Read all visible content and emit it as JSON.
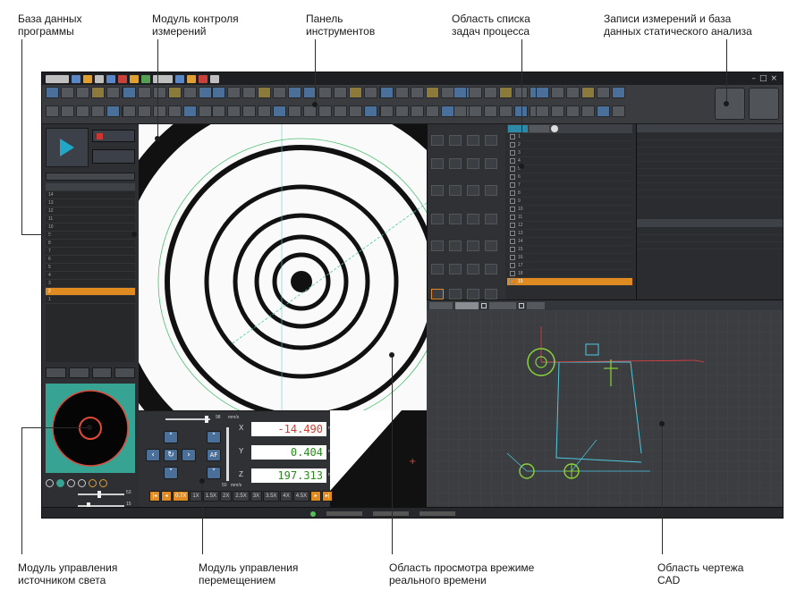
{
  "labels": {
    "program_database": [
      "База данных",
      "программы"
    ],
    "measure_control": [
      "Модуль контроля",
      "измерений"
    ],
    "toolbar": [
      "Панель",
      "инструментов"
    ],
    "task_list": [
      "Область списка",
      "задач процесса"
    ],
    "records": [
      "Записи измерений и база",
      "данных статического анализа"
    ],
    "light_control": [
      "Модуль управления",
      "источником света"
    ],
    "motion_control": [
      "Модуль управления",
      "перемещением"
    ],
    "live_view": [
      "Область просмотра врежиме",
      "реального времени"
    ],
    "cad_area": [
      "Область чертежа",
      "CAD"
    ]
  },
  "motion": {
    "x_label": "X",
    "x_value": "-14.490",
    "y_label": "Y",
    "y_value": "0.404",
    "z_label": "Z",
    "z_value": "197.313",
    "unit": "mm",
    "speed_value": "98",
    "speed_unit": "mm/s",
    "z_speed_unit": "mm/s",
    "z_speed_value": "50",
    "af_label": "AF"
  },
  "zoom_levels": [
    "0.7X",
    "1X",
    "1.5X",
    "2X",
    "2.5X",
    "3X",
    "3.5X",
    "4X",
    "4.5X"
  ],
  "zoom_selected": "0.7X",
  "light": {
    "slider1_value": "53",
    "slider2_value": "15"
  },
  "db_rows": [
    "14",
    "13",
    "12",
    "11",
    "10",
    "9",
    "8",
    "7",
    "6",
    "5",
    "4",
    "3",
    "2",
    "1"
  ],
  "db_selected": "2",
  "task_rows": [
    "1",
    "2",
    "3",
    "4",
    "5",
    "6",
    "7",
    "8",
    "9",
    "10",
    "11",
    "12",
    "13",
    "14",
    "15",
    "16",
    "17",
    "18",
    "19"
  ],
  "colors": {
    "accent_orange": "#e08a22",
    "accent_blue": "#21a7c7",
    "cad_green": "#8ad33a",
    "cad_cyan": "#4ec9e0",
    "cad_red": "#e04040",
    "light_teal": "#36a393"
  }
}
